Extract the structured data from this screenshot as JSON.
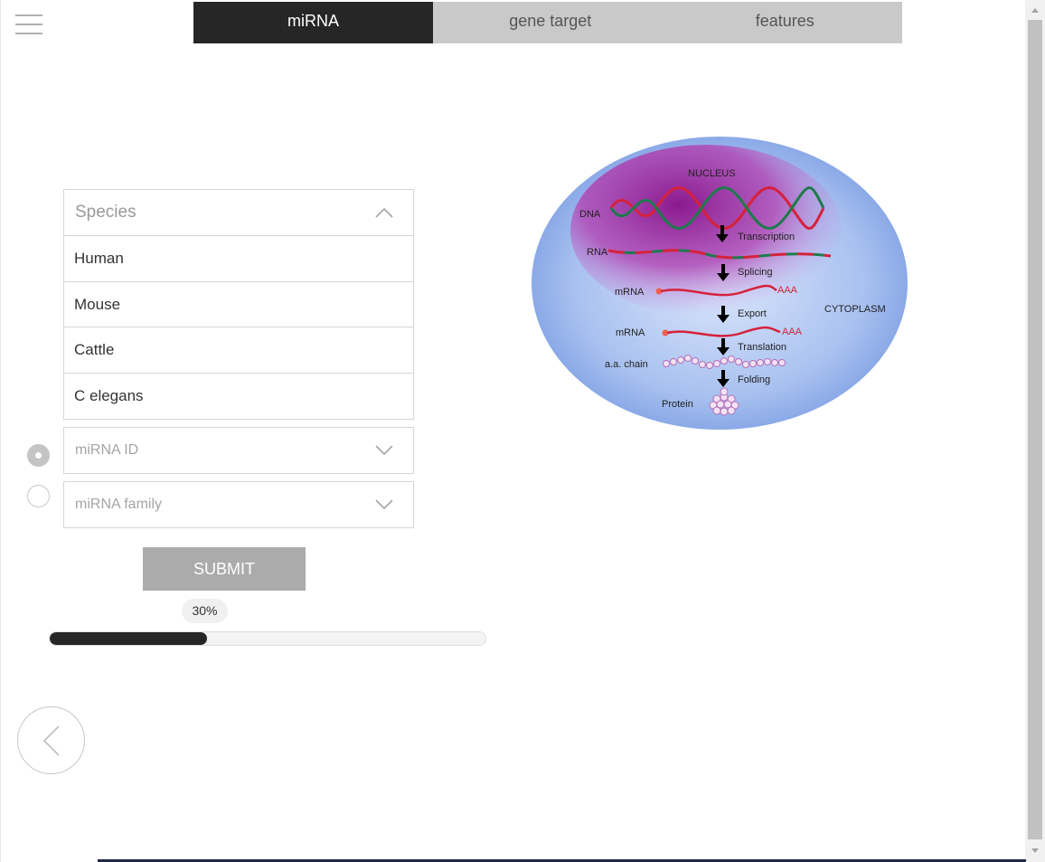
{
  "tabs": [
    {
      "label": "miRNA",
      "active": true
    },
    {
      "label": "gene target",
      "active": false
    },
    {
      "label": "features",
      "active": false
    }
  ],
  "species": {
    "placeholder": "Species",
    "options": [
      "Human",
      "Mouse",
      "Cattle",
      "C elegans"
    ]
  },
  "search_mode": {
    "mirna_id": {
      "placeholder": "miRNA ID",
      "checked": true
    },
    "mirna_family": {
      "placeholder": "miRNA family",
      "checked": false
    }
  },
  "submit_label": "SUBMIT",
  "progress": {
    "label": "30%",
    "value": 0.36
  },
  "diagram": {
    "nucleus": "NUCLEUS",
    "cytoplasm": "CYTOPLASM",
    "dna": "DNA",
    "rna": "RNA",
    "mrna": "mRNA",
    "aa_chain": "a.a. chain",
    "protein": "Protein",
    "poly_a": "AAA",
    "transcription": "Transcription",
    "splicing": "Splicing",
    "export": "Export",
    "translation": "Translation",
    "folding": "Folding"
  }
}
